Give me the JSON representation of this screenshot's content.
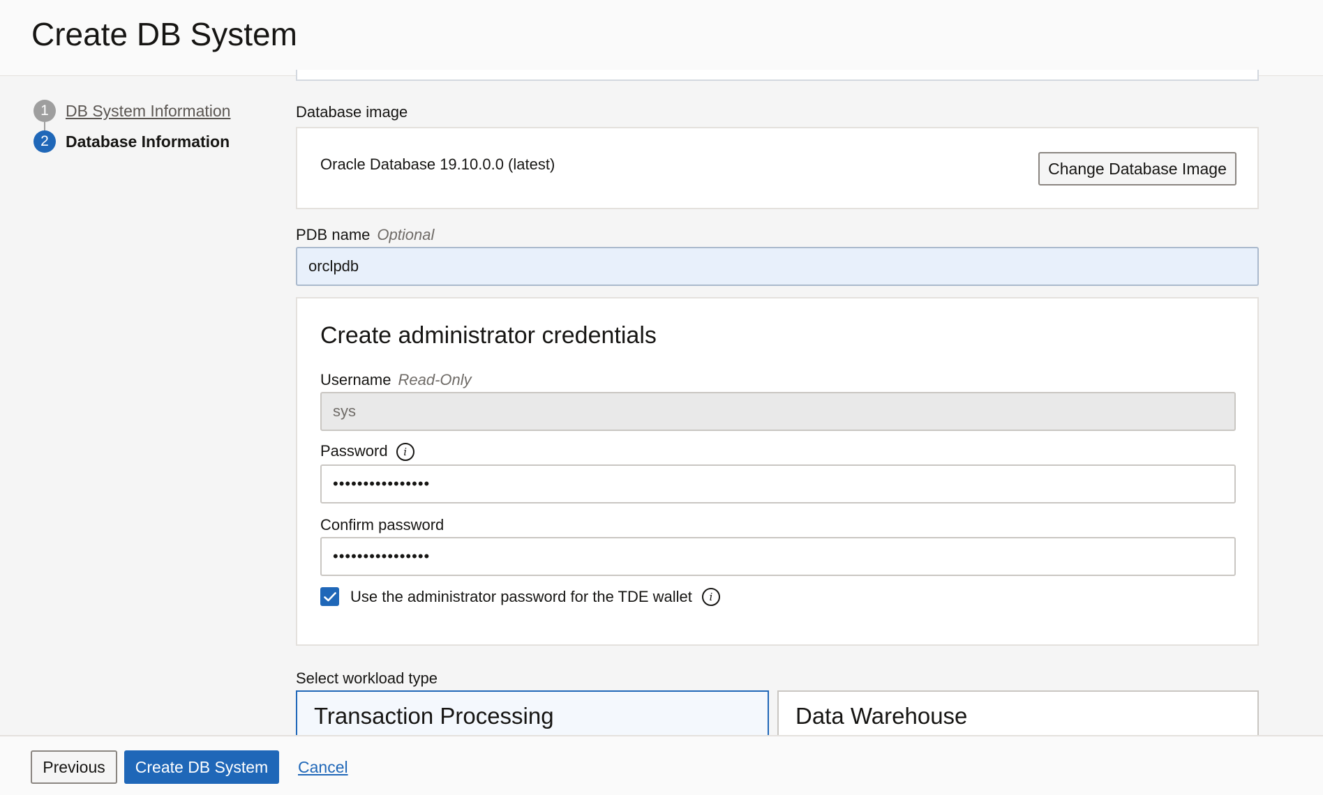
{
  "page": {
    "title": "Create DB System"
  },
  "steps": [
    {
      "number": "1",
      "label": "DB System Information"
    },
    {
      "number": "2",
      "label": "Database Information"
    }
  ],
  "database_image": {
    "label": "Database image",
    "value": "Oracle Database 19.10.0.0 (latest)",
    "change_button": "Change Database Image"
  },
  "pdb": {
    "label": "PDB name",
    "optional": "Optional",
    "value": "orclpdb"
  },
  "credentials": {
    "title": "Create administrator credentials",
    "username_label": "Username",
    "username_tag": "Read-Only",
    "username_value": "sys",
    "password_label": "Password",
    "password_value": "••••••••••••••••",
    "confirm_label": "Confirm password",
    "confirm_value": "••••••••••••••••",
    "tde_checkbox_label": "Use the administrator password for the TDE wallet",
    "tde_checked": true
  },
  "workload": {
    "label": "Select workload type",
    "options": [
      "Transaction Processing",
      "Data Warehouse"
    ],
    "selected": "Transaction Processing"
  },
  "footer": {
    "previous": "Previous",
    "create": "Create DB System",
    "cancel": "Cancel"
  },
  "colors": {
    "accent": "#1f67b8",
    "step_inactive": "#9e9e9e"
  },
  "icons": {
    "info": "info-circle-icon",
    "check": "checkmark-icon"
  }
}
